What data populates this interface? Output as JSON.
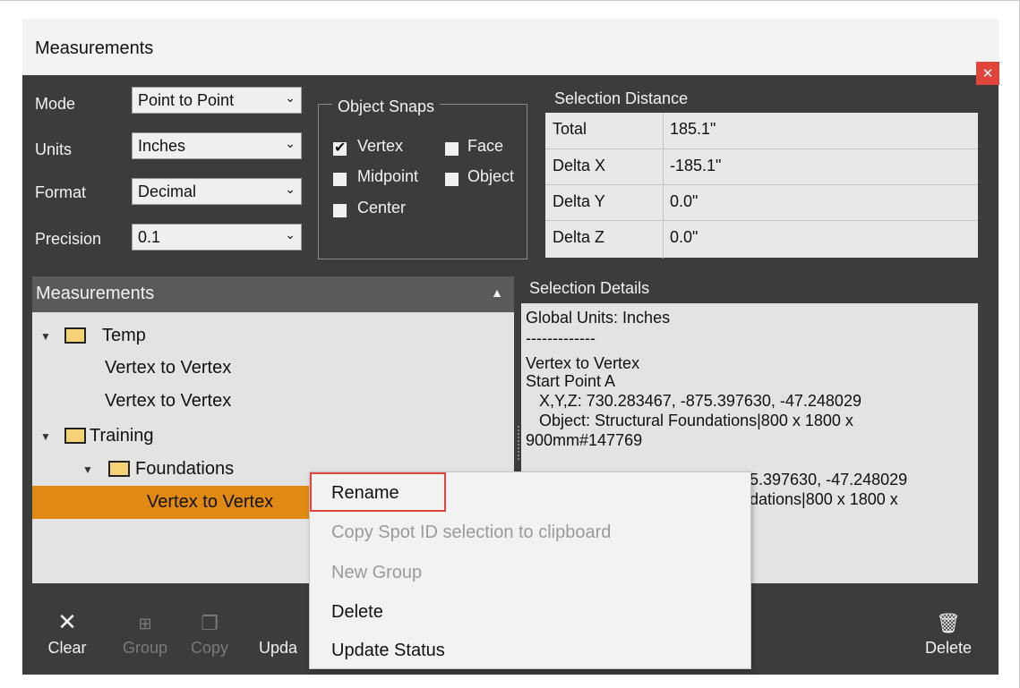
{
  "window": {
    "title": "Measurements"
  },
  "settings": {
    "mode_label": "Mode",
    "mode_value": "Point to Point",
    "units_label": "Units",
    "units_value": "Inches",
    "format_label": "Format",
    "format_value": "Decimal",
    "precision_label": "Precision",
    "precision_value": "0.1"
  },
  "snaps": {
    "title": "Object Snaps",
    "items": [
      {
        "label": "Vertex",
        "checked": true
      },
      {
        "label": "Face",
        "checked": false
      },
      {
        "label": "Midpoint",
        "checked": false
      },
      {
        "label": "Object",
        "checked": false
      },
      {
        "label": "Center",
        "checked": false
      }
    ]
  },
  "distance": {
    "title": "Selection Distance",
    "rows": [
      {
        "name": "Total",
        "value": "185.1\""
      },
      {
        "name": "Delta X",
        "value": "-185.1\""
      },
      {
        "name": "Delta Y",
        "value": "0.0\""
      },
      {
        "name": "Delta Z",
        "value": "0.0\""
      }
    ]
  },
  "measurements": {
    "header": "Measurements",
    "tree": [
      {
        "label": "Temp"
      },
      {
        "label": "Vertex to Vertex"
      },
      {
        "label": "Vertex to Vertex"
      },
      {
        "label": "Training"
      },
      {
        "label": "Foundations"
      },
      {
        "label": "Vertex to Vertex"
      }
    ]
  },
  "details": {
    "title": "Selection Details",
    "lines": [
      "Global Units: Inches",
      "-------------",
      "Vertex to Vertex",
      "Start Point A",
      "   X,Y,Z: 730.283467, -875.397630, -47.248029",
      "   Object: Structural Foundations|800 x 1800 x",
      "900mm#147769",
      "",
      "5.397630, -47.248029",
      "dations|800 x 1800 x"
    ]
  },
  "toolbar": {
    "clear": "Clear",
    "group": "Group",
    "copy": "Copy",
    "update": "Upda",
    "delete": "Delete"
  },
  "context_menu": {
    "items": [
      {
        "label": "Rename",
        "enabled": true
      },
      {
        "label": "Copy Spot ID selection to clipboard",
        "enabled": false
      },
      {
        "label": "New Group",
        "enabled": false
      },
      {
        "label": "Delete",
        "enabled": true
      },
      {
        "label": "Update Status",
        "enabled": true
      }
    ]
  },
  "colors": {
    "accent": "#e08a14",
    "close": "#e0453b",
    "panel": "#3c3c3c"
  }
}
